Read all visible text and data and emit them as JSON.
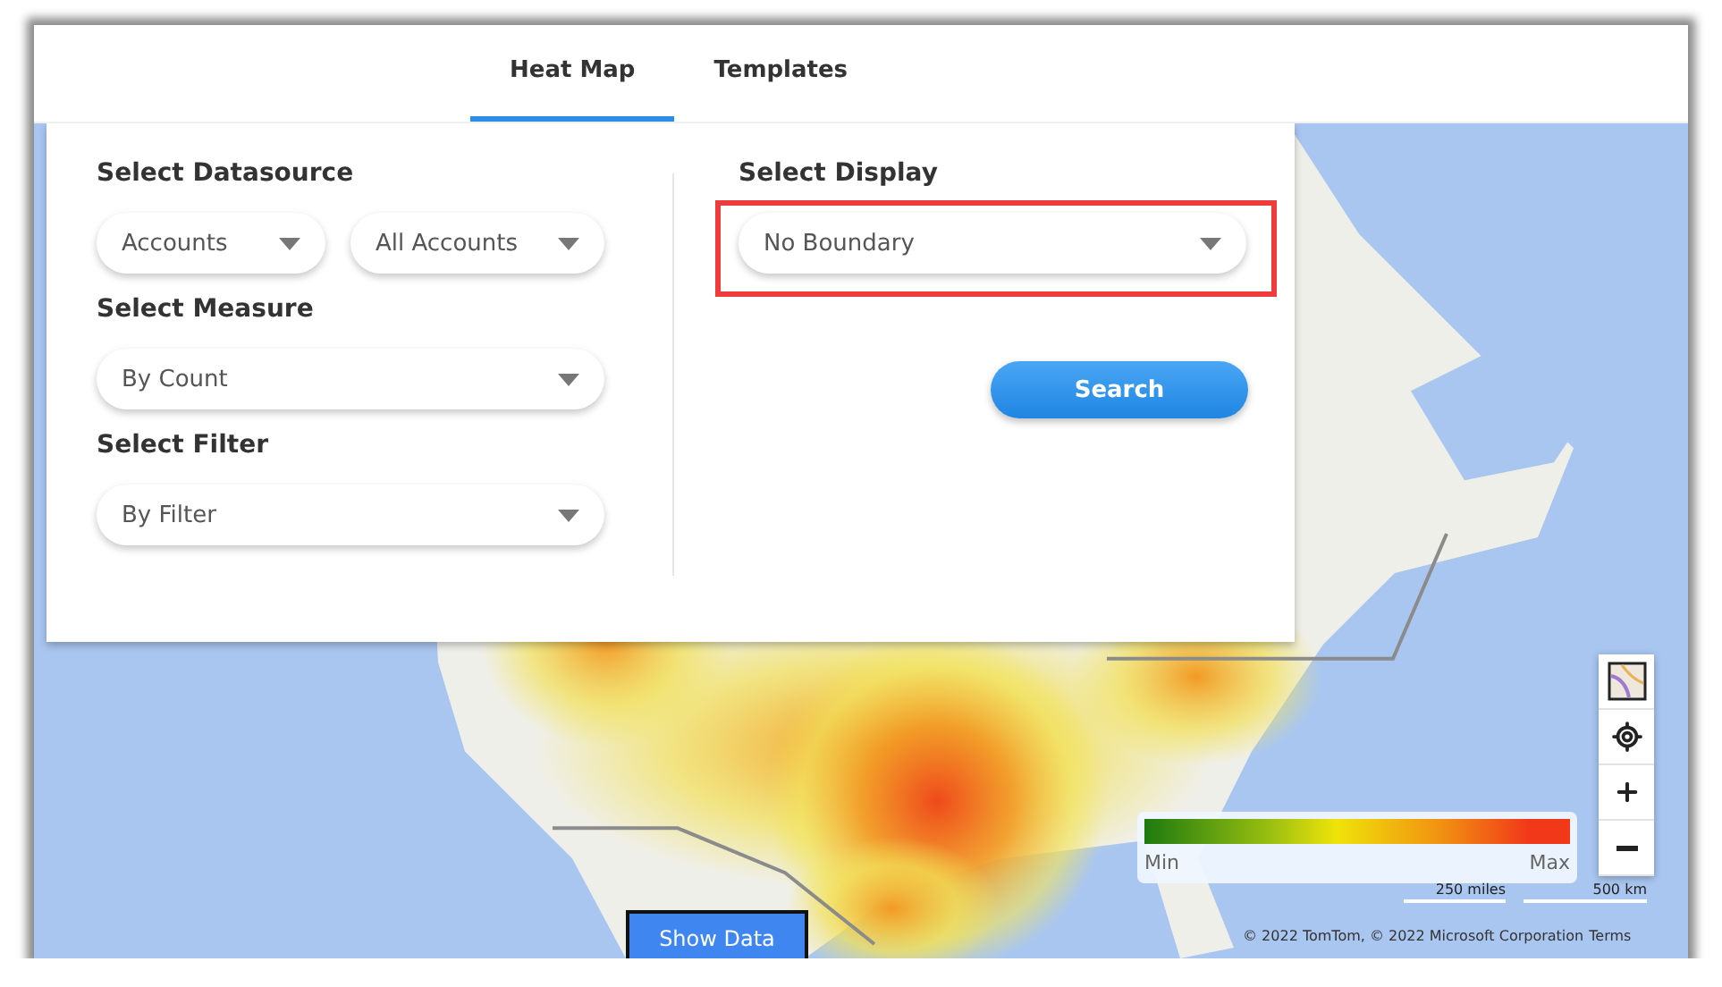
{
  "tabs": [
    {
      "label": "Heat Map",
      "selected": true
    },
    {
      "label": "Templates",
      "selected": false
    }
  ],
  "datasource": {
    "label": "Select Datasource",
    "selects": [
      "Accounts",
      "All Accounts"
    ]
  },
  "measure": {
    "label": "Select Measure",
    "value": "By Count"
  },
  "filter": {
    "label": "Select Filter",
    "value": "By Filter"
  },
  "display": {
    "label": "Select Display",
    "value": "No Boundary",
    "highlighted": true
  },
  "search_button": "Search",
  "legend": {
    "min": "Min",
    "max": "Max"
  },
  "scale": [
    "250 miles",
    "500 km"
  ],
  "attribution": {
    "text": "© 2022 TomTom, © 2022 Microsoft Corporation",
    "link": "Terms"
  },
  "show_data_button": "Show Data"
}
